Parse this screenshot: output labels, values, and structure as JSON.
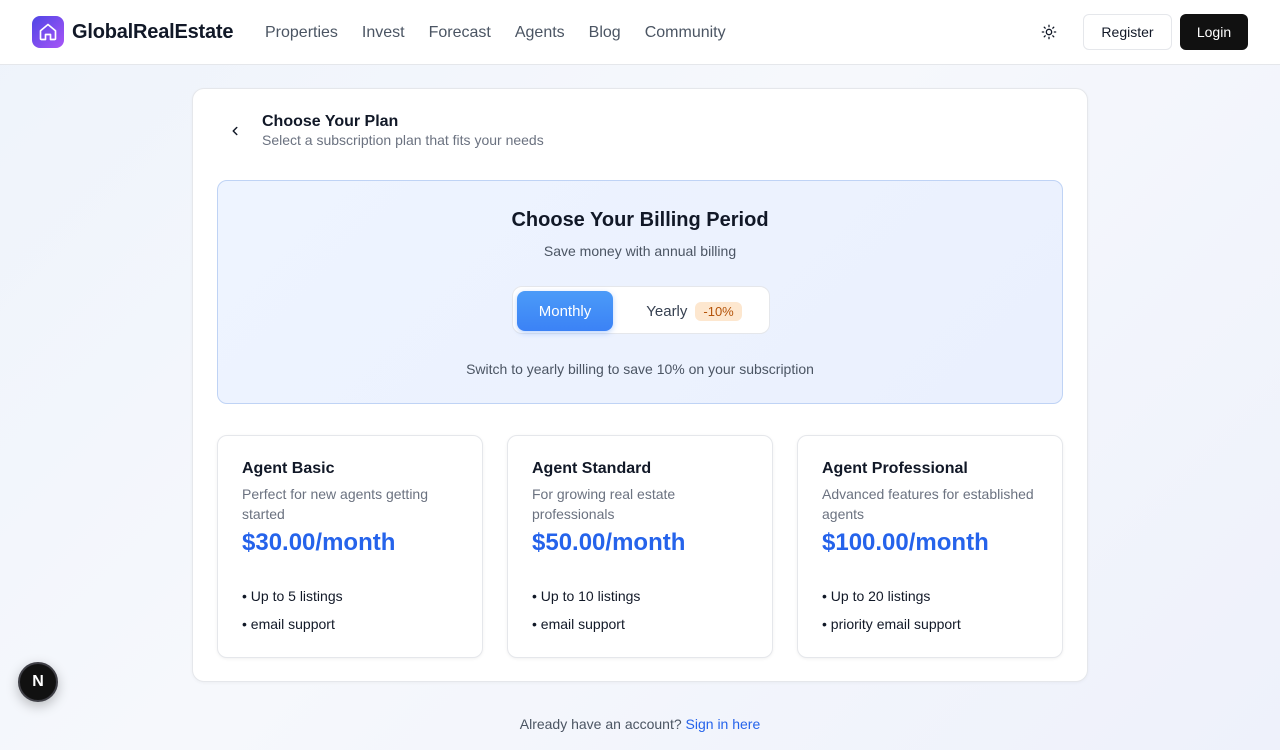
{
  "header": {
    "brand": "GlobalRealEstate",
    "brand_icon": "home-icon",
    "nav": [
      "Properties",
      "Invest",
      "Forecast",
      "Agents",
      "Blog",
      "Community"
    ],
    "theme_icon": "sun-icon",
    "register_label": "Register",
    "login_label": "Login"
  },
  "page": {
    "title": "Choose Your Plan",
    "subtitle": "Select a subscription plan that fits your needs",
    "back_icon": "chevron-left-icon"
  },
  "billing": {
    "title": "Choose Your Billing Period",
    "subtitle": "Save money with annual billing",
    "monthly_label": "Monthly",
    "yearly_label": "Yearly",
    "yearly_discount": "-10%",
    "selected": "Monthly",
    "note": "Switch to yearly billing to save 10% on your subscription"
  },
  "plans": [
    {
      "name": "Agent Basic",
      "description": "Perfect for new agents getting started",
      "price": "$30.00/month",
      "features": [
        "• Up to 5 listings",
        "• email support"
      ]
    },
    {
      "name": "Agent Standard",
      "description": "For growing real estate professionals",
      "price": "$50.00/month",
      "features": [
        "• Up to 10 listings",
        "• email support"
      ]
    },
    {
      "name": "Agent Professional",
      "description": "Advanced features for established agents",
      "price": "$100.00/month",
      "features": [
        "• Up to 20 listings",
        "• priority email support"
      ]
    }
  ],
  "footer": {
    "prompt": "Already have an account?",
    "link": "Sign in here"
  },
  "dev_badge": {
    "label": "N"
  },
  "colors": {
    "accent": "#2563eb",
    "toggle_active": "#3b82f6",
    "brand_gradient_start": "#4f46e5",
    "brand_gradient_end": "#a855f7"
  }
}
